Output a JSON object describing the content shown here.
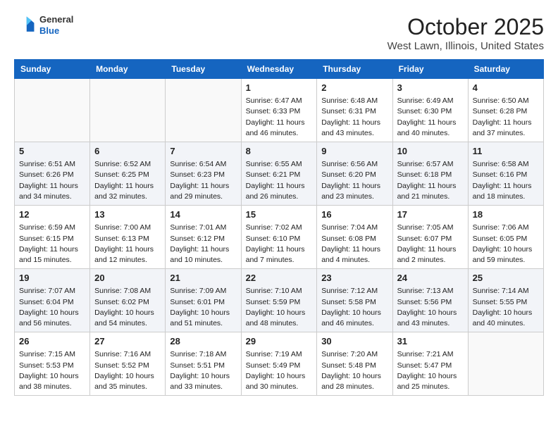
{
  "header": {
    "logo_general": "General",
    "logo_blue": "Blue",
    "month_title": "October 2025",
    "location": "West Lawn, Illinois, United States"
  },
  "weekdays": [
    "Sunday",
    "Monday",
    "Tuesday",
    "Wednesday",
    "Thursday",
    "Friday",
    "Saturday"
  ],
  "weeks": [
    [
      {
        "day": "",
        "info": ""
      },
      {
        "day": "",
        "info": ""
      },
      {
        "day": "",
        "info": ""
      },
      {
        "day": "1",
        "info": "Sunrise: 6:47 AM\nSunset: 6:33 PM\nDaylight: 11 hours and 46 minutes."
      },
      {
        "day": "2",
        "info": "Sunrise: 6:48 AM\nSunset: 6:31 PM\nDaylight: 11 hours and 43 minutes."
      },
      {
        "day": "3",
        "info": "Sunrise: 6:49 AM\nSunset: 6:30 PM\nDaylight: 11 hours and 40 minutes."
      },
      {
        "day": "4",
        "info": "Sunrise: 6:50 AM\nSunset: 6:28 PM\nDaylight: 11 hours and 37 minutes."
      }
    ],
    [
      {
        "day": "5",
        "info": "Sunrise: 6:51 AM\nSunset: 6:26 PM\nDaylight: 11 hours and 34 minutes."
      },
      {
        "day": "6",
        "info": "Sunrise: 6:52 AM\nSunset: 6:25 PM\nDaylight: 11 hours and 32 minutes."
      },
      {
        "day": "7",
        "info": "Sunrise: 6:54 AM\nSunset: 6:23 PM\nDaylight: 11 hours and 29 minutes."
      },
      {
        "day": "8",
        "info": "Sunrise: 6:55 AM\nSunset: 6:21 PM\nDaylight: 11 hours and 26 minutes."
      },
      {
        "day": "9",
        "info": "Sunrise: 6:56 AM\nSunset: 6:20 PM\nDaylight: 11 hours and 23 minutes."
      },
      {
        "day": "10",
        "info": "Sunrise: 6:57 AM\nSunset: 6:18 PM\nDaylight: 11 hours and 21 minutes."
      },
      {
        "day": "11",
        "info": "Sunrise: 6:58 AM\nSunset: 6:16 PM\nDaylight: 11 hours and 18 minutes."
      }
    ],
    [
      {
        "day": "12",
        "info": "Sunrise: 6:59 AM\nSunset: 6:15 PM\nDaylight: 11 hours and 15 minutes."
      },
      {
        "day": "13",
        "info": "Sunrise: 7:00 AM\nSunset: 6:13 PM\nDaylight: 11 hours and 12 minutes."
      },
      {
        "day": "14",
        "info": "Sunrise: 7:01 AM\nSunset: 6:12 PM\nDaylight: 11 hours and 10 minutes."
      },
      {
        "day": "15",
        "info": "Sunrise: 7:02 AM\nSunset: 6:10 PM\nDaylight: 11 hours and 7 minutes."
      },
      {
        "day": "16",
        "info": "Sunrise: 7:04 AM\nSunset: 6:08 PM\nDaylight: 11 hours and 4 minutes."
      },
      {
        "day": "17",
        "info": "Sunrise: 7:05 AM\nSunset: 6:07 PM\nDaylight: 11 hours and 2 minutes."
      },
      {
        "day": "18",
        "info": "Sunrise: 7:06 AM\nSunset: 6:05 PM\nDaylight: 10 hours and 59 minutes."
      }
    ],
    [
      {
        "day": "19",
        "info": "Sunrise: 7:07 AM\nSunset: 6:04 PM\nDaylight: 10 hours and 56 minutes."
      },
      {
        "day": "20",
        "info": "Sunrise: 7:08 AM\nSunset: 6:02 PM\nDaylight: 10 hours and 54 minutes."
      },
      {
        "day": "21",
        "info": "Sunrise: 7:09 AM\nSunset: 6:01 PM\nDaylight: 10 hours and 51 minutes."
      },
      {
        "day": "22",
        "info": "Sunrise: 7:10 AM\nSunset: 5:59 PM\nDaylight: 10 hours and 48 minutes."
      },
      {
        "day": "23",
        "info": "Sunrise: 7:12 AM\nSunset: 5:58 PM\nDaylight: 10 hours and 46 minutes."
      },
      {
        "day": "24",
        "info": "Sunrise: 7:13 AM\nSunset: 5:56 PM\nDaylight: 10 hours and 43 minutes."
      },
      {
        "day": "25",
        "info": "Sunrise: 7:14 AM\nSunset: 5:55 PM\nDaylight: 10 hours and 40 minutes."
      }
    ],
    [
      {
        "day": "26",
        "info": "Sunrise: 7:15 AM\nSunset: 5:53 PM\nDaylight: 10 hours and 38 minutes."
      },
      {
        "day": "27",
        "info": "Sunrise: 7:16 AM\nSunset: 5:52 PM\nDaylight: 10 hours and 35 minutes."
      },
      {
        "day": "28",
        "info": "Sunrise: 7:18 AM\nSunset: 5:51 PM\nDaylight: 10 hours and 33 minutes."
      },
      {
        "day": "29",
        "info": "Sunrise: 7:19 AM\nSunset: 5:49 PM\nDaylight: 10 hours and 30 minutes."
      },
      {
        "day": "30",
        "info": "Sunrise: 7:20 AM\nSunset: 5:48 PM\nDaylight: 10 hours and 28 minutes."
      },
      {
        "day": "31",
        "info": "Sunrise: 7:21 AM\nSunset: 5:47 PM\nDaylight: 10 hours and 25 minutes."
      },
      {
        "day": "",
        "info": ""
      }
    ]
  ]
}
